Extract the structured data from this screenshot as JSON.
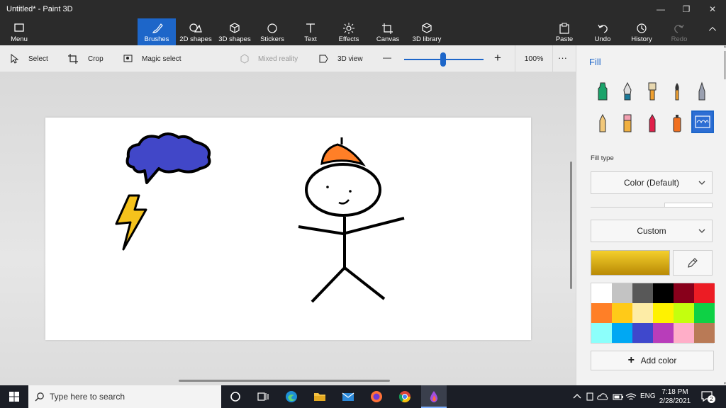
{
  "window": {
    "title": "Untitled* - Paint 3D",
    "minimize": "—",
    "maximize": "❐",
    "close": "✕"
  },
  "ribbon": {
    "menu": "Menu",
    "tools": [
      {
        "label": "Brushes",
        "icon": "brush-icon"
      },
      {
        "label": "2D shapes",
        "icon": "2d-shapes-icon"
      },
      {
        "label": "3D shapes",
        "icon": "3d-shapes-icon"
      },
      {
        "label": "Stickers",
        "icon": "stickers-icon"
      },
      {
        "label": "Text",
        "icon": "text-icon"
      },
      {
        "label": "Effects",
        "icon": "effects-icon"
      },
      {
        "label": "Canvas",
        "icon": "canvas-icon"
      },
      {
        "label": "3D library",
        "icon": "3d-library-icon"
      }
    ],
    "paste": "Paste",
    "undo": "Undo",
    "history": "History",
    "redo": "Redo",
    "accent": "#1d66c9"
  },
  "toolbar2": {
    "select": "Select",
    "crop": "Crop",
    "magic_select": "Magic select",
    "mixed_reality": "Mixed reality",
    "view_3d": "3D view",
    "zoom_minus": "—",
    "zoom_plus": "+",
    "zoom_level": "100%",
    "more": "···"
  },
  "panel": {
    "title": "Fill",
    "fill_type_label": "Fill type",
    "fill_type_value": "Color (Default)",
    "color_mode_value": "Custom",
    "add_color": "Add color",
    "current_color": "#e0b020",
    "palette": [
      "#ffffff",
      "#c3c3c3",
      "#585858",
      "#000000",
      "#88001b",
      "#ec1c24",
      "#ff7f27",
      "#ffca18",
      "#fdeca6",
      "#fff200",
      "#c4ff0e",
      "#0ed145",
      "#8cfffb",
      "#00a8f3",
      "#3f48cc",
      "#b83dba",
      "#ffaec8",
      "#b97a56"
    ]
  },
  "taskbar": {
    "search_placeholder": "Type here to search",
    "lang": "ENG",
    "time": "7:18 PM",
    "date": "2/28/2021",
    "notifications": "2"
  }
}
